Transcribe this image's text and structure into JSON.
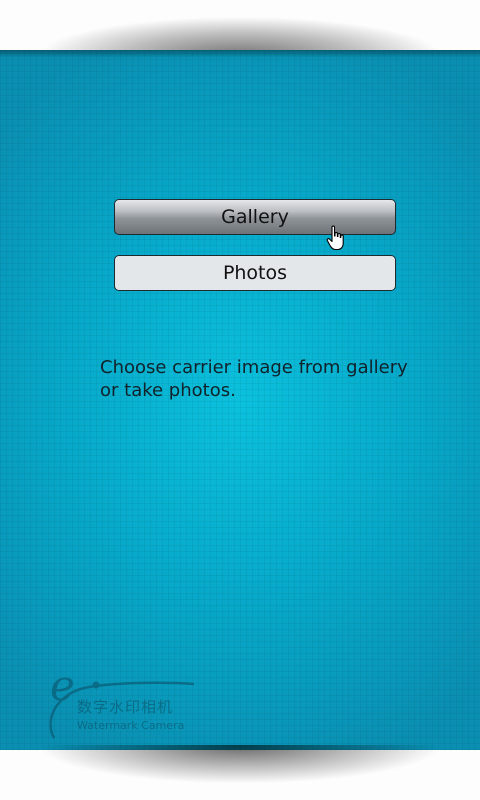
{
  "buttons": {
    "gallery_label": "Gallery",
    "photos_label": "Photos"
  },
  "hint": {
    "text": "Choose carrier image from gallery or take photos."
  },
  "logo": {
    "mark": "e",
    "name_cn": "数字水印相机",
    "name_en": "Watermark Camera"
  },
  "icons": {
    "cursor": "hand-pointer-icon"
  },
  "colors": {
    "background_center": "#0bc1dd",
    "background_edge": "#0a8fb2",
    "photos_button": "#e4e7e9"
  }
}
